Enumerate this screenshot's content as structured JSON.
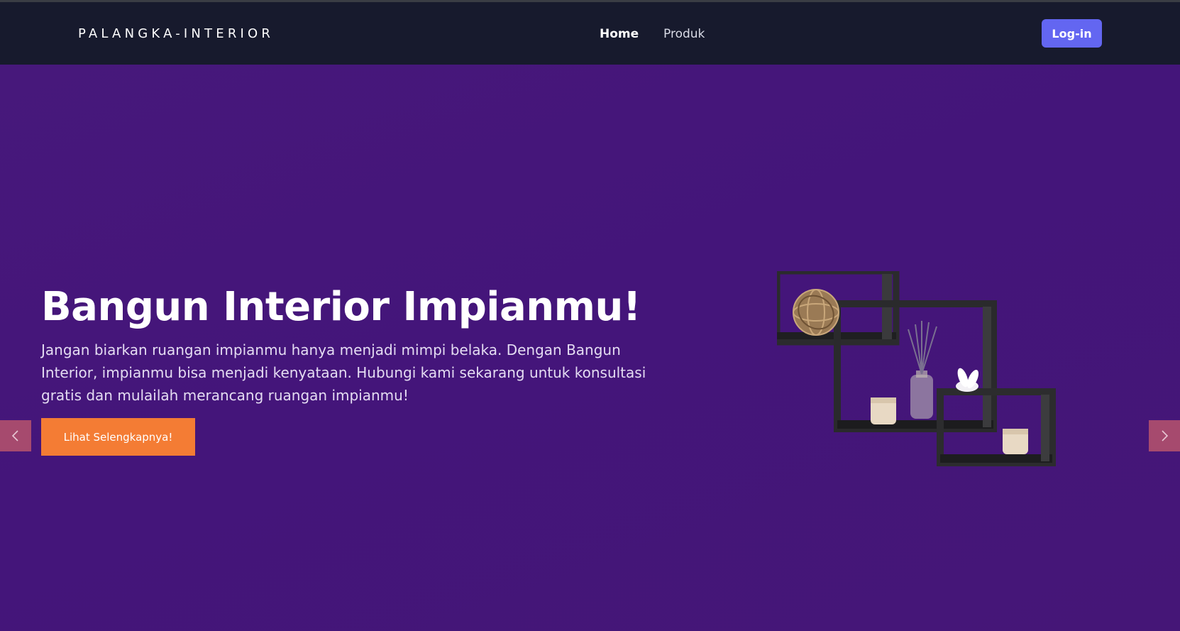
{
  "navbar": {
    "brand": "PALANGKA-INTERIOR",
    "links": [
      {
        "label": "Home",
        "active": true
      },
      {
        "label": "Produk",
        "active": false
      }
    ],
    "login_label": "Log-in"
  },
  "hero": {
    "title": "Bangun Interior Impianmu!",
    "description": "Jangan biarkan ruangan impianmu hanya menjadi mimpi belaka. Dengan Bangun Interior, impianmu bisa menjadi kenyataan. Hubungi kami sekarang untuk konsultasi gratis dan mulailah merancang ruangan impianmu!",
    "cta_label": "Lihat Selengkapnya!",
    "image_icon": "wall-shelf-decor-image"
  },
  "carousel": {
    "prev_icon": "chevron-left-icon",
    "next_icon": "chevron-right-icon"
  },
  "colors": {
    "navbar_bg": "#171a2d",
    "hero_bg": "#451578",
    "login_button": "#6366f1",
    "cta_button": "#f47c34",
    "carousel_arrow": "#a64a6e"
  }
}
